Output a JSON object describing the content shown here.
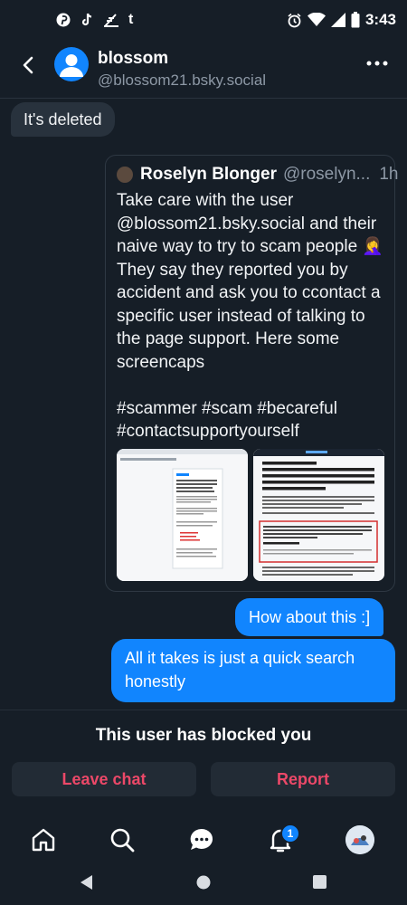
{
  "status_bar": {
    "notif_icons": [
      "pinterest-icon",
      "tiktok-icon",
      "feather-icon",
      "tumblr-icon"
    ],
    "time": "3:43"
  },
  "header": {
    "name": "blossom",
    "handle": "@blossom21.bsky.social"
  },
  "messages": [
    {
      "direction": "incoming",
      "text": "It's deleted"
    },
    {
      "direction": "outgoing",
      "type": "quoted_post",
      "author": "Roselyn Blonger",
      "handle": "@roselyn...",
      "age": "1h",
      "text": "Take care with the user @blossom21.bsky.social and their naive way to try to scam people 🤦‍♀️ They say they reported you by accident and ask you to ccontact a specific user instead of talking to the page support. Here some screencaps\n\n#scammer #scam #becareful #contactsupportyourself",
      "image_count": 2
    },
    {
      "direction": "outgoing",
      "text": "How about this :]"
    },
    {
      "direction": "outgoing",
      "text": "All it takes is just a quick search honestly"
    }
  ],
  "footer": {
    "blocked_text": "This user has blocked you",
    "leave_label": "Leave chat",
    "report_label": "Report"
  },
  "tabbar": {
    "notification_count": "1"
  },
  "colors": {
    "background": "#161e27",
    "accent": "#1185fe",
    "danger": "#ec4868",
    "incoming_bubble": "#28323d"
  }
}
